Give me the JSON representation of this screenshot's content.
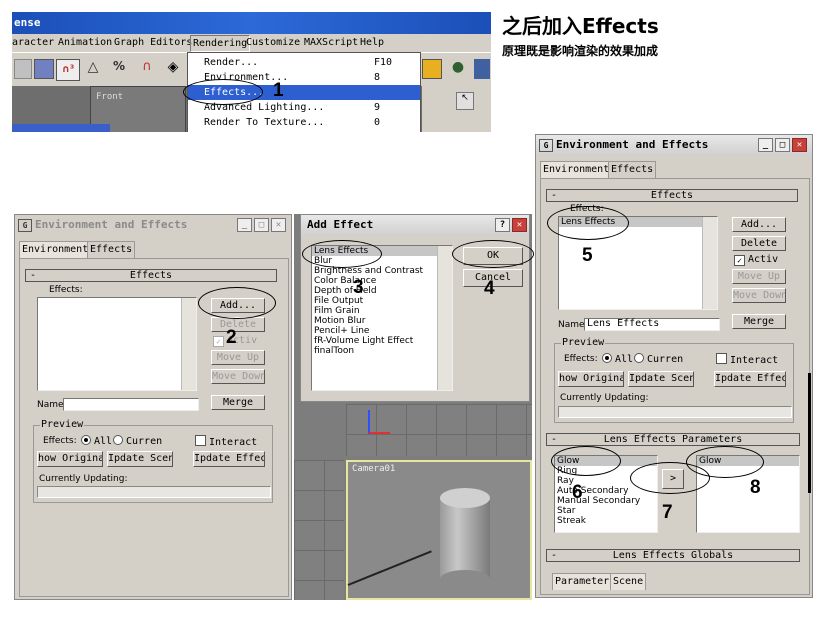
{
  "heading": {
    "title": "之后加入Effects",
    "subtitle": "原理既是影响渲染的效果加成"
  },
  "menu_shot": {
    "title_fragment": "ense",
    "menubar": [
      "aracter",
      "Animation",
      "Graph Editors",
      "Rendering",
      "Customize",
      "MAXScript",
      "Help"
    ],
    "viewport_label": "Front",
    "dropdown": [
      {
        "label": "Render...",
        "key": "F10",
        "selected": false
      },
      {
        "label": "Environment...",
        "key": "8",
        "selected": false
      },
      {
        "label": "Effects...",
        "key": "",
        "selected": true
      },
      {
        "label": "Advanced Lighting...",
        "key": "9",
        "selected": false
      },
      {
        "label": "Render To Texture...",
        "key": "0",
        "selected": false
      }
    ]
  },
  "callouts": [
    "1",
    "2",
    "3",
    "4",
    "5",
    "6",
    "7",
    "8"
  ],
  "env_window_left": {
    "title": "Environment and Effects",
    "tabs": [
      "Environment",
      "Effects"
    ],
    "rollout_effects": "Effects",
    "effects_label": "Effects:",
    "buttons": {
      "add": "Add...",
      "delete": "Delete",
      "move_up": "Move Up",
      "move_down": "Move Down",
      "merge": "Merge"
    },
    "active_label": "Activ",
    "name_label": "Name:",
    "name_value": "",
    "preview_group": "Preview",
    "effects_radio_label": "Effects:",
    "radio_all": "All",
    "radio_current": "Curren",
    "interactive": "Interact",
    "btn_show_original": "how Origina",
    "btn_update_scene": "Ipdate Scene",
    "btn_update_effect": "Ipdate Effect",
    "currently_updating": "Currently Updating:"
  },
  "add_effect_dialog": {
    "title": "Add Effect",
    "help_button": "?",
    "ok": "OK",
    "cancel": "Cancel",
    "items": [
      "Lens Effects",
      "Blur",
      "Brightness and Contrast",
      "Color Balance",
      "Depth of Field",
      "File Output",
      "Film Grain",
      "Motion Blur",
      "Pencil+ Line",
      "fR-Volume Light Effect",
      "finalToon"
    ]
  },
  "viewport_camera": {
    "label": "Camera01"
  },
  "env_window_right": {
    "title": "Environment and Effects",
    "tabs": [
      "Environment",
      "Effects"
    ],
    "rollout_effects": "Effects",
    "effects_label": "Effects:",
    "effects_list": [
      "Lens Effects"
    ],
    "buttons": {
      "add": "Add...",
      "delete": "Delete",
      "move_up": "Move Up",
      "move_down": "Move Down",
      "merge": "Merge"
    },
    "active_label": "Activ",
    "name_label": "Name:",
    "name_value": "Lens Effects",
    "preview_group": "Preview",
    "effects_radio_label": "Effects:",
    "radio_all": "All",
    "radio_current": "Curren",
    "interactive": "Interact",
    "btn_show_original": "how Origina",
    "btn_update_scene": "Ipdate Scene",
    "btn_update_effect": "Ipdate Effect",
    "currently_updating": "Currently Updating:",
    "rollout_lens_params": "Lens Effects Parameters",
    "lens_list": [
      "Glow",
      "Ring",
      "Ray",
      "Auto Secondary",
      "Manual Secondary",
      "Star",
      "Streak"
    ],
    "arrow_button": ">",
    "applied_list": [
      "Glow"
    ],
    "rollout_lens_globals": "Lens Effects Globals",
    "bottom_tabs": [
      "Parameters",
      "Scene"
    ]
  }
}
